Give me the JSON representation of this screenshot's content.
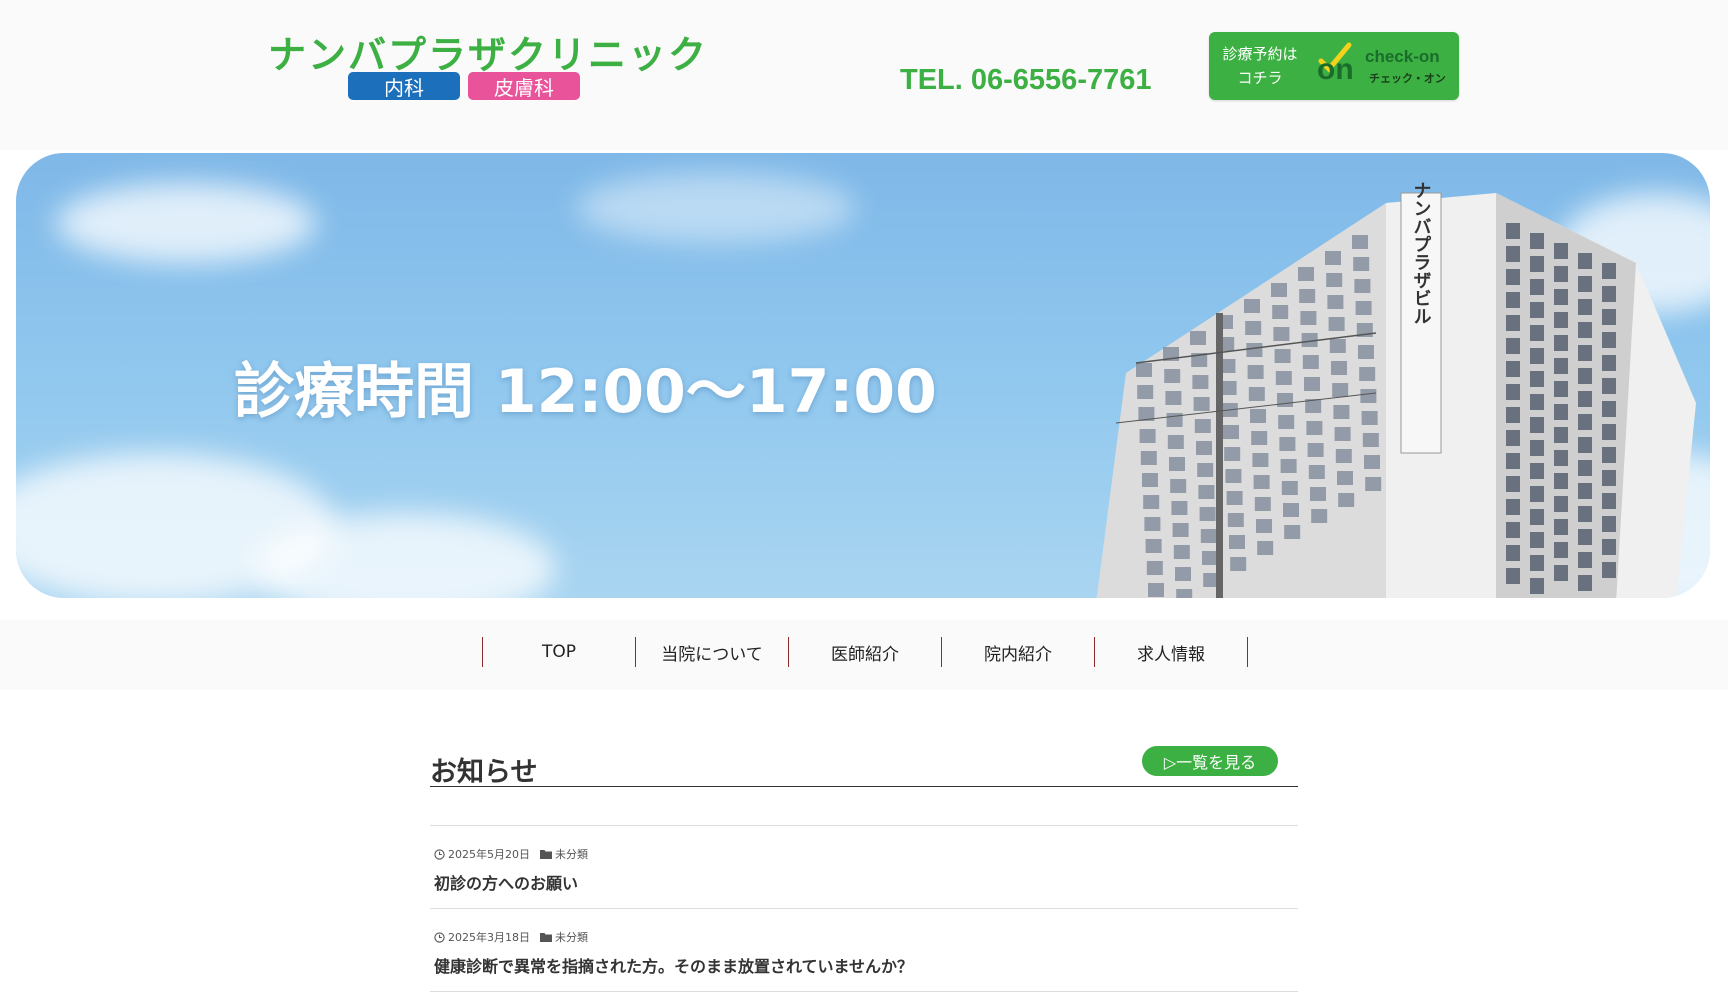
{
  "header": {
    "logo_text": "ナンバプラザクリニック",
    "badge_internal": "内科",
    "badge_derma": "皮膚科",
    "tel": "TEL. 06-6556-7761",
    "reserve_text": "診療予約は\nコチラ",
    "reserve_logo_main": "on",
    "reserve_logo_sub": "check-on",
    "reserve_logo_kana": "チェック・オン"
  },
  "hero": {
    "title": "診療時間 12:00～17:00",
    "building_sign": "ナンバプラザビル"
  },
  "nav": {
    "items": [
      {
        "label": "TOP"
      },
      {
        "label": "当院について"
      },
      {
        "label": "医師紹介"
      },
      {
        "label": "院内紹介"
      },
      {
        "label": "求人情報"
      }
    ]
  },
  "news": {
    "title": "お知らせ",
    "more_label": "▷一覧を見る",
    "items": [
      {
        "date": "2025年5月20日",
        "category": "未分類",
        "title": "初診の方へのお願い"
      },
      {
        "date": "2025年3月18日",
        "category": "未分類",
        "title": "健康診断で異常を指摘された方。そのまま放置されていませんか？"
      }
    ]
  },
  "colors": {
    "brand_green": "#3cb043",
    "badge_blue": "#1c6fba",
    "badge_pink": "#e8539a",
    "nav_divider": "#8b2a2a"
  }
}
